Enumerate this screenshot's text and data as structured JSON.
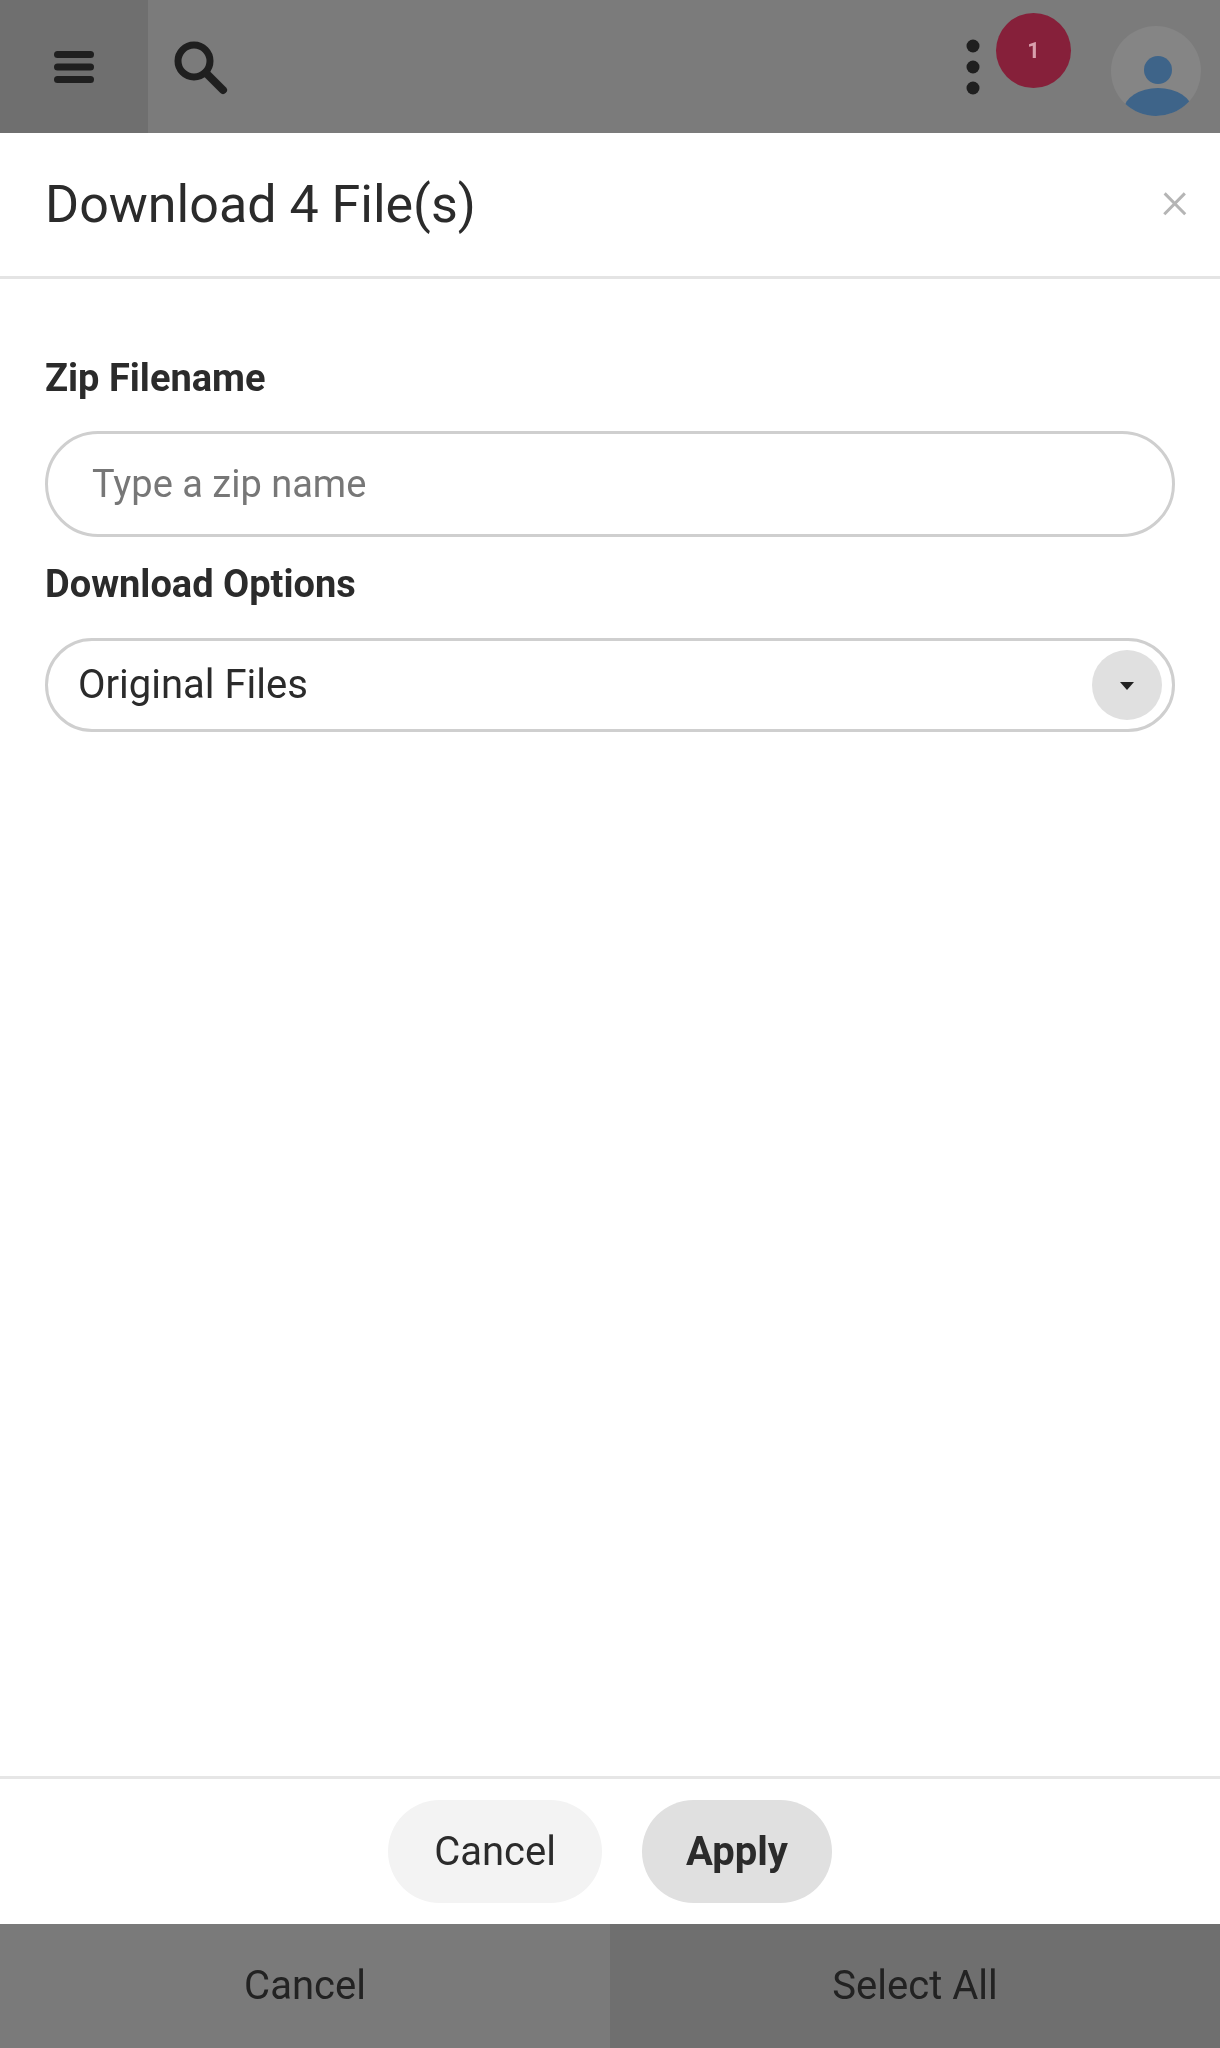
{
  "top_bar": {
    "notification_count": "1"
  },
  "dialog": {
    "title": "Download 4 File(s)",
    "close": "×",
    "fields": [
      {
        "kind": "text",
        "label": "Zip Filename",
        "placeholder": "Type a zip name"
      },
      {
        "kind": "select",
        "label": "Download Options",
        "value": "Original Files"
      }
    ],
    "buttons": [
      {
        "label": "Cancel",
        "primary": false
      },
      {
        "label": "Apply",
        "primary": true
      }
    ]
  },
  "bottom_bar": [
    {
      "label": "Cancel"
    },
    {
      "label": "Select All"
    }
  ]
}
